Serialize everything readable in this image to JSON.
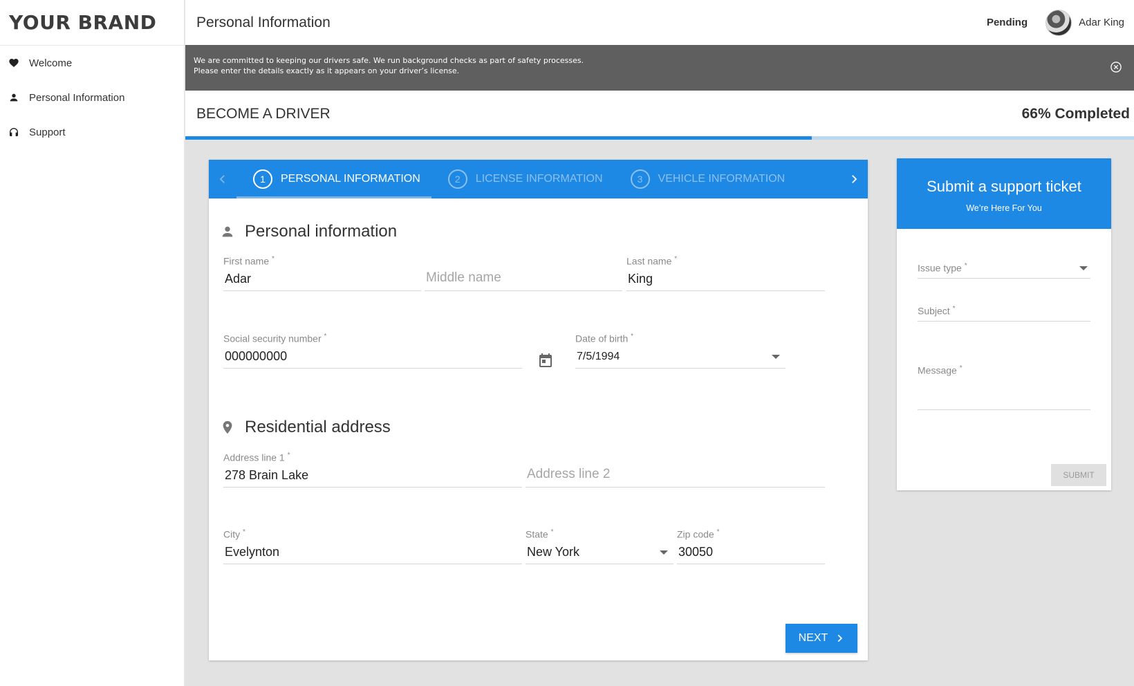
{
  "brand": "YOUR BRAND",
  "sidebar": {
    "items": [
      {
        "label": "Welcome",
        "icon": "heart-icon"
      },
      {
        "label": "Personal Information",
        "icon": "person-icon"
      },
      {
        "label": "Support",
        "icon": "headset-icon"
      }
    ]
  },
  "header": {
    "title": "Personal Information",
    "status": "Pending",
    "user_name": "Adar King"
  },
  "banner": {
    "line1": "We are committed to keeping our drivers safe. We run background checks as part of safety processes.",
    "line2": "Please enter the details exactly as it appears on your driver’s license."
  },
  "progress": {
    "title": "BECOME A DRIVER",
    "percent_label": "66% Completed",
    "percent": 66
  },
  "stepper": {
    "steps": [
      {
        "number": "1",
        "label": "PERSONAL INFORMATION",
        "active": true
      },
      {
        "number": "2",
        "label": "LICENSE INFORMATION",
        "active": false
      },
      {
        "number": "3",
        "label": "VEHICLE INFORMATION",
        "active": false
      }
    ]
  },
  "personal": {
    "section_title": "Personal information",
    "first_name": {
      "label": "First name",
      "value": "Adar"
    },
    "middle_name": {
      "placeholder": "Middle name"
    },
    "last_name": {
      "label": "Last name",
      "value": "King"
    },
    "ssn": {
      "label": "Social security number",
      "value": "000000000"
    },
    "dob": {
      "label": "Date of birth",
      "value": "7/5/1994"
    }
  },
  "address": {
    "section_title": "Residential address",
    "line1": {
      "label": "Address line 1",
      "value": "278 Brain Lake"
    },
    "line2": {
      "placeholder": "Address line 2"
    },
    "city": {
      "label": "City",
      "value": "Evelynton"
    },
    "state": {
      "label": "State",
      "value": "New York"
    },
    "zip": {
      "label": "Zip code",
      "value": "30050"
    }
  },
  "next_label": "NEXT",
  "required_mark": "*",
  "support": {
    "title": "Submit a support ticket",
    "subtitle": "We’re Here For You",
    "issue_type": "Issue type",
    "subject": "Subject",
    "message": "Message",
    "submit_label": "SUBMIT"
  },
  "colors": {
    "accent": "#1e88e5",
    "banner_bg": "#5f5f5f",
    "page_bg": "#e2e2e2"
  }
}
